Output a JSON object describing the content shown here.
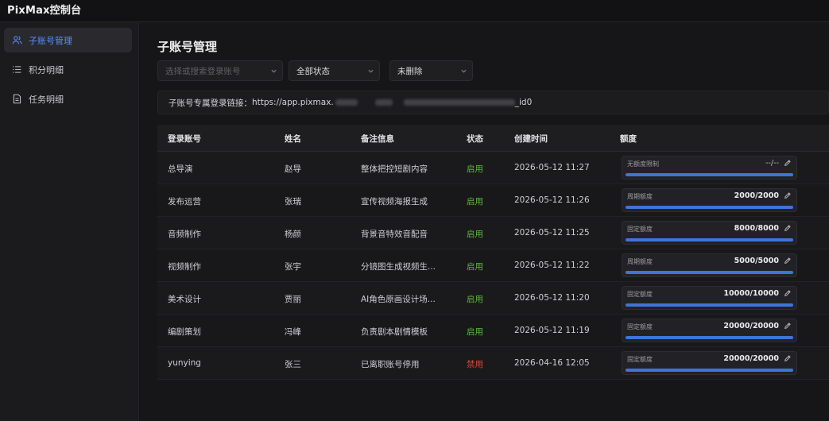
{
  "app": {
    "title": "PixMax控制台"
  },
  "sidebar": {
    "items": [
      {
        "label": "子账号管理",
        "icon": "users-icon",
        "active": true
      },
      {
        "label": "积分明细",
        "icon": "list-icon",
        "active": false
      },
      {
        "label": "任务明细",
        "icon": "document-icon",
        "active": false
      }
    ]
  },
  "page": {
    "title": "子账号管理"
  },
  "filters": {
    "search_placeholder": "选择或搜索登录账号",
    "status_value": "全部状态",
    "deleted_value": "未删除"
  },
  "link": {
    "label": "子账号专属登录链接：",
    "url_start": "https://app.pixmax.",
    "url_end": "_id0"
  },
  "table": {
    "headers": {
      "account": "登录账号",
      "name": "姓名",
      "note": "备注信息",
      "status": "状态",
      "created": "创建时间",
      "quota": "额度"
    },
    "rows": [
      {
        "account": "总导演",
        "name": "赵导",
        "note": "整体把控短剧内容",
        "status": "启用",
        "status_enabled": true,
        "created": "2026-05-12 11:27",
        "quota_type": "无额度限制",
        "quota_value": "--/--",
        "quota_fraction": 1.0
      },
      {
        "account": "发布运营",
        "name": "张瑞",
        "note": "宣传视频海报生成",
        "status": "启用",
        "status_enabled": true,
        "created": "2026-05-12 11:26",
        "quota_type": "周期额度",
        "quota_value": "2000/2000",
        "quota_fraction": 1.0
      },
      {
        "account": "音频制作",
        "name": "杨颜",
        "note": "背景音特效音配音",
        "status": "启用",
        "status_enabled": true,
        "created": "2026-05-12 11:25",
        "quota_type": "固定额度",
        "quota_value": "8000/8000",
        "quota_fraction": 1.0
      },
      {
        "account": "视频制作",
        "name": "张宇",
        "note": "分镜图生成视频生...",
        "status": "启用",
        "status_enabled": true,
        "created": "2026-05-12 11:22",
        "quota_type": "周期额度",
        "quota_value": "5000/5000",
        "quota_fraction": 1.0
      },
      {
        "account": "美术设计",
        "name": "贾丽",
        "note": "AI角色原画设计场...",
        "status": "启用",
        "status_enabled": true,
        "created": "2026-05-12 11:20",
        "quota_type": "固定额度",
        "quota_value": "10000/10000",
        "quota_fraction": 1.0
      },
      {
        "account": "编剧策划",
        "name": "冯峰",
        "note": "负责剧本剧情模板",
        "status": "启用",
        "status_enabled": true,
        "created": "2026-05-12 11:19",
        "quota_type": "固定额度",
        "quota_value": "20000/20000",
        "quota_fraction": 1.0
      },
      {
        "account": "yunying",
        "name": "张三",
        "note": "已离职账号停用",
        "status": "禁用",
        "status_enabled": false,
        "created": "2026-04-16 12:05",
        "quota_type": "固定额度",
        "quota_value": "20000/20000",
        "quota_fraction": 1.0
      }
    ]
  },
  "colors": {
    "accent": "#5b8ff9",
    "progress": "#3f74d8",
    "enabled": "#5fb83b",
    "disabled": "#e0493c"
  }
}
